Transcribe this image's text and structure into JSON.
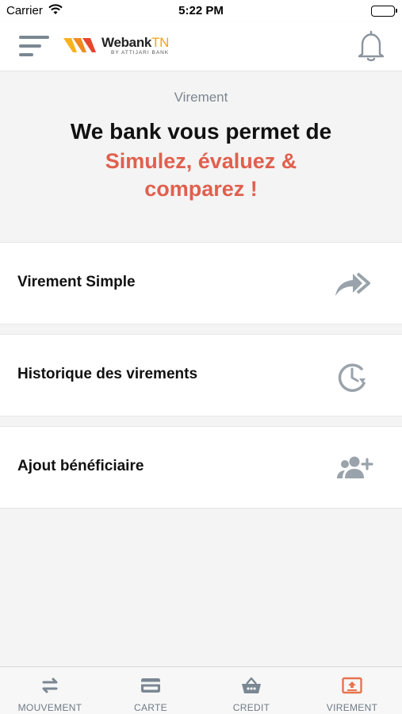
{
  "status_bar": {
    "carrier": "Carrier",
    "time": "5:22 PM"
  },
  "header": {
    "logo": {
      "brand": "Webank",
      "brand_suffix": "TN",
      "subtitle": "BY ATTIJARI BANK"
    },
    "menu_icon": "hamburger-menu-icon",
    "notification_icon": "bell-icon"
  },
  "hero": {
    "section_title": "Virement",
    "headline": "We bank vous permet de",
    "tagline": "Simulez, évaluez & comparez !"
  },
  "menu": {
    "items": [
      {
        "label": "Virement Simple",
        "icon": "double-forward-arrow-icon"
      },
      {
        "label": "Historique des virements",
        "icon": "history-clock-icon"
      },
      {
        "label": "Ajout bénéficiaire",
        "icon": "add-user-icon"
      }
    ]
  },
  "tab_bar": {
    "tabs": [
      {
        "label": "MOUVEMENT",
        "icon": "transfer-arrows-icon",
        "active": false
      },
      {
        "label": "CARTE",
        "icon": "credit-card-icon",
        "active": false
      },
      {
        "label": "CREDIT",
        "icon": "basket-icon",
        "active": false
      },
      {
        "label": "VIREMENT",
        "icon": "upload-box-icon",
        "active": true
      }
    ]
  },
  "colors": {
    "accent": "#e0604e",
    "active_tab": "#e8734f",
    "icon_gray": "#8a949e",
    "logo_orange": "#f4a11b",
    "logo_red": "#e8452c"
  }
}
